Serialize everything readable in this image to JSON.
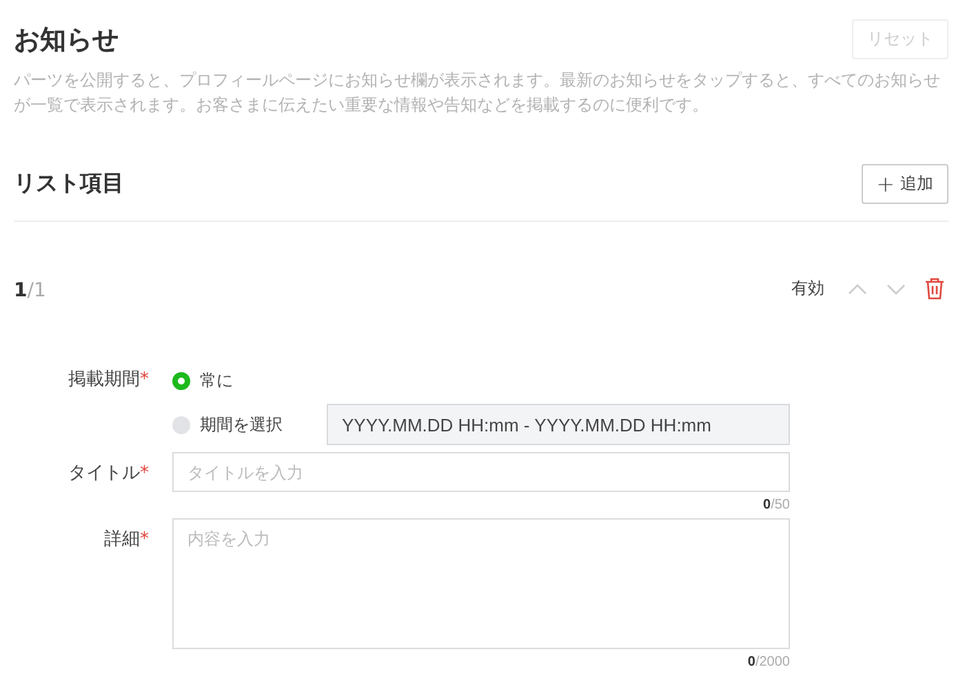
{
  "header": {
    "title": "お知らせ",
    "reset_button": {
      "label": "リセット",
      "disabled": true
    },
    "description": "パーツを公開すると、プロフィールページにお知らせ欄が表示されます。最新のお知らせをタップすると、すべてのお知らせが一覧で表示されます。お客さまに伝えたい重要な情報や告知などを掲載するのに便利です。"
  },
  "list_section": {
    "title": "リスト項目",
    "add_button": {
      "icon": "+",
      "label": "追加"
    }
  },
  "item": {
    "index": "1",
    "total": "/1",
    "status": "有効",
    "move_buttons": [
      {
        "kind": "up",
        "disabled": true
      },
      {
        "kind": "down",
        "disabled": true
      }
    ],
    "fields": [
      {
        "kind": "radio",
        "label": "掲載期間",
        "mark": "*",
        "options": [
          {
            "label": "常に",
            "selected": true
          },
          {
            "label": "期間を選択",
            "selected": false,
            "range_field": {
              "value": "YYYY.MM.DD HH:mm - YYYY.MM.DD HH:mm",
              "disabled": true
            }
          }
        ]
      },
      {
        "kind": "input",
        "label": "タイトル",
        "mark": "*",
        "placeholder": "タイトルを入力",
        "counter": "**0**/50"
      },
      {
        "kind": "textarea",
        "label": "詳細",
        "mark": "*",
        "placeholder": "内容を入力",
        "counter": "**0**/2000"
      }
    ]
  }
}
